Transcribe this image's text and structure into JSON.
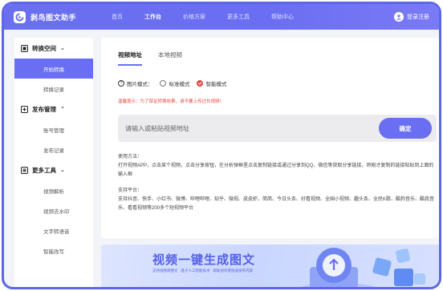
{
  "app": {
    "name": "剥鸟图文助手"
  },
  "nav": {
    "items": [
      {
        "label": "首页",
        "active": false
      },
      {
        "label": "工作台",
        "active": true
      },
      {
        "label": "价格方案",
        "active": false
      },
      {
        "label": "更多工具",
        "active": false
      },
      {
        "label": "帮助中心",
        "active": false
      }
    ],
    "login_label": "登录注册"
  },
  "sidebar": {
    "groups": [
      {
        "title": "转换空间",
        "icon": "convert-icon",
        "expanded": true,
        "items": [
          "开始转换",
          "转换记录"
        ],
        "active_item": "开始转换"
      },
      {
        "title": "发布管理",
        "icon": "publish-icon",
        "expanded": true,
        "items": [
          "账号管理",
          "发布记录"
        ]
      },
      {
        "title": "更多工具",
        "icon": "tools-icon",
        "expanded": true,
        "items": [
          "视频解析",
          "视频去水印",
          "文字转语音",
          "智能改写"
        ]
      }
    ]
  },
  "main": {
    "tabs": [
      {
        "label": "视频地址",
        "active": true
      },
      {
        "label": "本地视频",
        "active": false
      }
    ],
    "mode_label": "图片模式：",
    "modes": [
      {
        "label": "标准模式",
        "checked": false
      },
      {
        "label": "智能模式",
        "checked": true
      }
    ],
    "warning": "温馨提示：为了保证转换效果，请不要上传过长视频！",
    "url_placeholder": "请输入或粘贴视频地址",
    "confirm_label": "确定",
    "usage_title": "使用方法：",
    "usage_text": "打开视频APP，点击某个视频，点击分享按钮，在分析弹框里点击复制链接或通过分享到QQ、微信等获取分享链接，将刚才复制的链接粘贴到上面的输入框",
    "platform_title": "支持平台：",
    "platform_text": "支持抖音、快手、小红书、微博、哔哩哔哩、知乎、微视、皮皮虾、简简、今日头条、好看视频、全国小视频、趣头条、全民K歌、酷狗音乐、酷我音乐、看看视频等200多个短视频平台"
  },
  "banner": {
    "title": "视频一键生成图文",
    "subtitle": "支持视频转图文 · 基于人工智能技术 · 帮助创作者快速发布内容"
  },
  "colors": {
    "accent": "#6a6ef2",
    "warning": "#e8463f",
    "frame": "#5b67e6"
  }
}
